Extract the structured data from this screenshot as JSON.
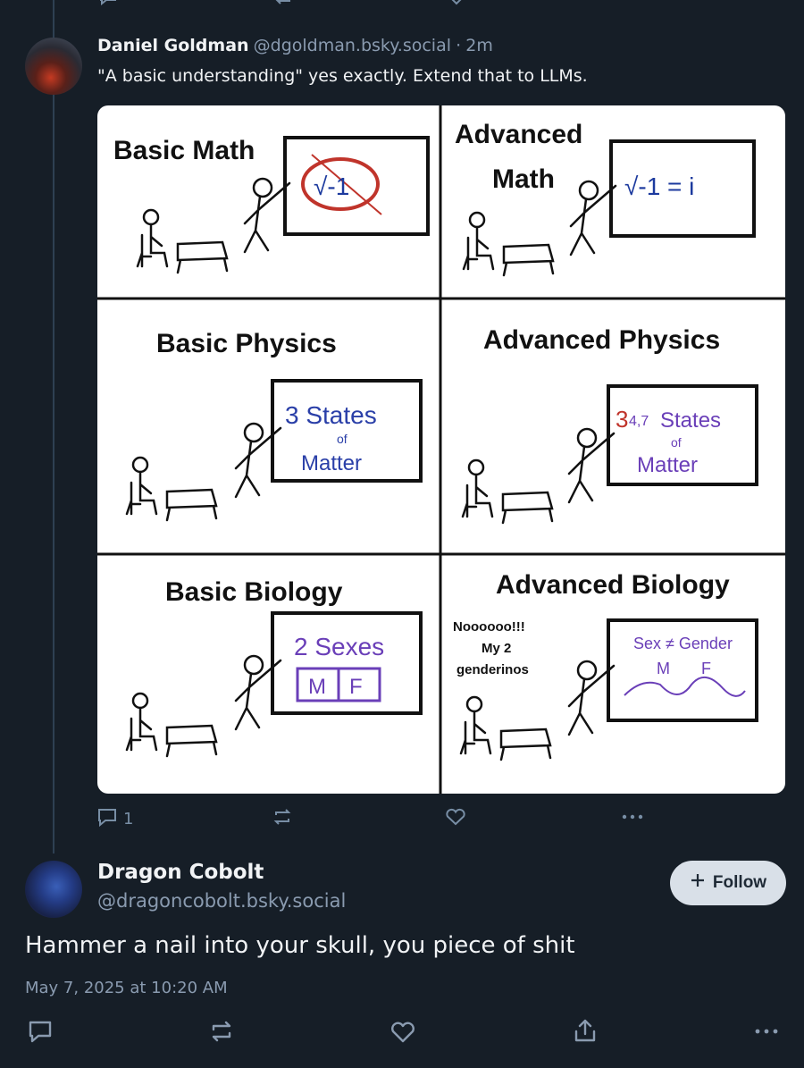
{
  "post1": {
    "author_name": "Daniel Goldman",
    "author_handle": "@dgoldman.bsky.social",
    "separator": "·",
    "time": "2m",
    "text": "\"A basic understanding\" yes exactly. Extend that to LLMs.",
    "reply_count": "1"
  },
  "meme": {
    "panels": [
      {
        "title": "Basic Math",
        "board": "√-1"
      },
      {
        "title_line1": "Advanced",
        "title_line2": "Math",
        "board": "√-1 = i"
      },
      {
        "title": "Basic Physics",
        "board_line1": "3 States",
        "board_line2": "of",
        "board_line3": "Matter"
      },
      {
        "title": "Advanced Physics",
        "board_prefix": "3",
        "board_struck": "4,7",
        "board_line1": "States",
        "board_line2": "of",
        "board_line3": "Matter"
      },
      {
        "title": "Basic Biology",
        "board_line1": "2 Sexes",
        "box_m": "M",
        "box_f": "F"
      },
      {
        "title": "Advanced Biology",
        "board_line1": "Sex ≠ Gender",
        "label_m": "M",
        "label_f": "F",
        "speech1": "Noooooo!!!",
        "speech2": "My 2",
        "speech3": "genderinos"
      }
    ]
  },
  "post2": {
    "author_name": "Dragon Cobolt",
    "author_handle": "@dragoncobolt.bsky.social",
    "follow_label": "Follow",
    "text": "Hammer a nail into your skull, you piece of shit",
    "timestamp": "May 7, 2025 at 10:20 AM"
  },
  "icons": {
    "reply": "reply-icon",
    "repost": "repost-icon",
    "like": "heart-icon",
    "more": "more-icon",
    "share": "share-icon"
  },
  "colors": {
    "background": "#161e27",
    "text": "#f1f3f5",
    "muted": "#8a9bb0",
    "follow_bg": "#d9e0e8"
  }
}
